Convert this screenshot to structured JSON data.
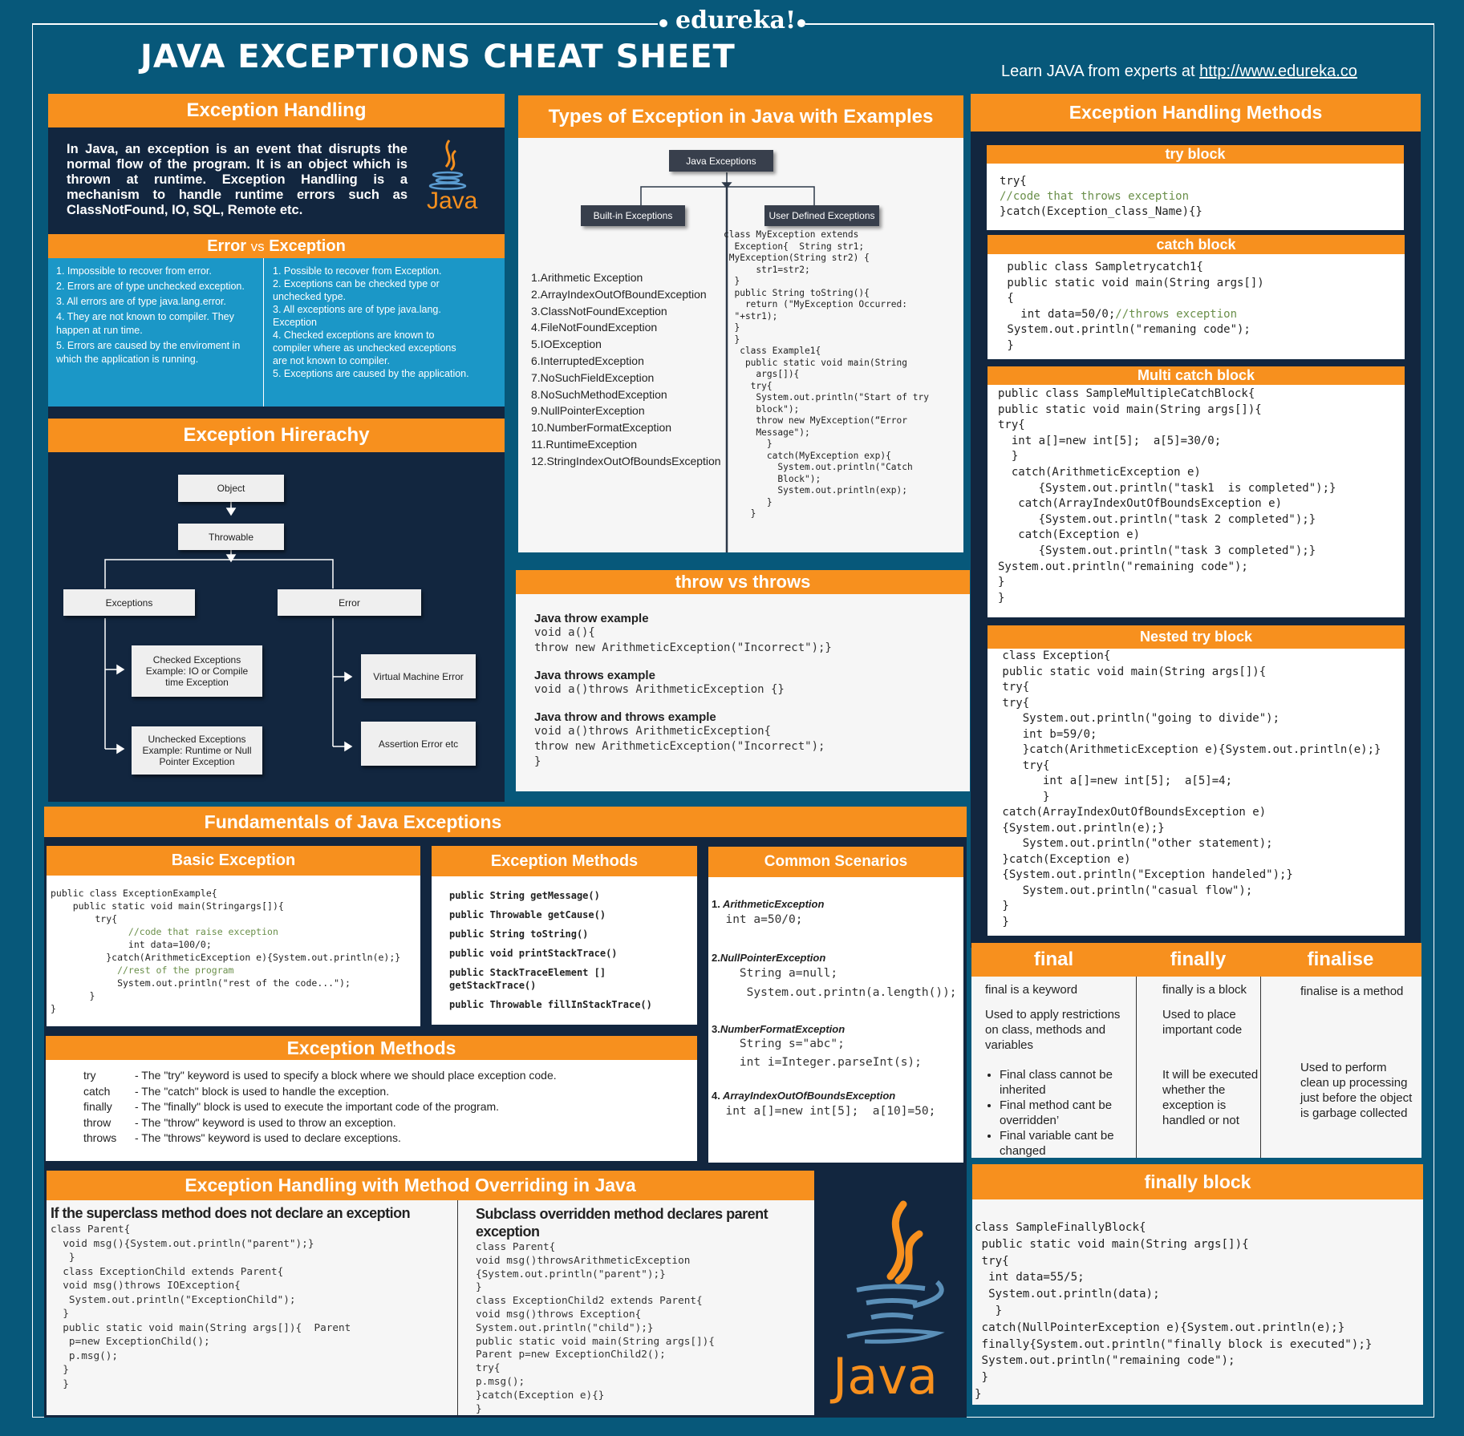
{
  "header": {
    "brand": "edureka!",
    "title": "JAVA EXCEPTIONS CHEAT  SHEET",
    "learn_prefix": "Learn JAVA from experts at ",
    "learn_link": "http://www.edureka.co"
  },
  "exception_handling": {
    "title": "Exception Handling",
    "text": "In Java, an exception is an event that disrupts the normal flow of the program. It is an object which is thrown at runtime. Exception Handling is a mechanism to handle runtime errors such as ClassNotFound, IO, SQL, Remote etc.",
    "logo_text": "Java"
  },
  "error_vs_exception": {
    "title_a": "Error",
    "title_vs": "vs",
    "title_b": "Exception",
    "errors": [
      "1. Impossible to recover from error.",
      "2. Errors are of type unchecked exception.",
      "3. All errors are of type java.lang.error.",
      "4. They are not known to compiler. They happen at run time.",
      "5. Errors are caused by the enviroment in which the application is running."
    ],
    "exceptions": [
      "1. Possible to recover from Exception.",
      "2. Exceptions can be checked type or unchecked type.",
      "3. All exceptions are of type java.lang. Exception",
      "4. Checked exceptions are known to compiler where as unchecked exceptions are not known to compiler.",
      "5. Exceptions are caused by the application."
    ]
  },
  "hierarchy": {
    "title": "Exception Hirerachy",
    "object": "Object",
    "throwable": "Throwable",
    "exceptions": "Exceptions",
    "error": "Error",
    "checked": "Checked Exceptions Example: IO or Compile time Exception",
    "unchecked": "Unchecked Exceptions Example: Runtime or Null Pointer Exception",
    "vm_error": "Virtual Machine Error",
    "assertion": "Assertion Error etc"
  },
  "types": {
    "title": "Types of Exception in Java with Examples",
    "root": "Java Exceptions",
    "builtin": "Built-in Exceptions",
    "userdef": "User Defined Exceptions",
    "builtin_list": [
      "1.Arithmetic Exception",
      "2.ArrayIndexOutOfBoundException",
      "3.ClassNotFoundException",
      "4.FileNotFoundException",
      "5.IOException",
      "6.InterruptedException",
      "7.NoSuchFieldException",
      "8.NoSuchMethodException",
      "9.NullPointerException",
      "10.NumberFormatException",
      "11.RuntimeException",
      "12.StringIndexOutOfBoundsException"
    ],
    "user_code": "class MyException extends\n  Exception{  String str1;\n MyException(String str2) {\n      str1=str2;\n  }\n  public String toString(){\n    return (\"MyException Occurred:\n  \"+str1);\n  }\n  }\n   class Example1{\n    public static void main(String\n      args[]){\n     try{\n      System.out.println(\"Start of try\n      block\");\n      throw new MyException(“Error\n      Message\");\n        }\n        catch(MyException exp){\n          System.out.println(\"Catch\n          Block\");\n          System.out.println(exp);\n        }\n     }"
  },
  "throw_vs_throws": {
    "title": "throw vs throws",
    "items": [
      {
        "heading": "Java throw example",
        "code": "void a(){\nthrow new ArithmeticException(\"Incorrect\");}"
      },
      {
        "heading": "Java throws example",
        "code": "void a()throws ArithmeticException {}"
      },
      {
        "heading": "Java throw and throws example",
        "code": "void a()throws ArithmeticException{\nthrow new ArithmeticException(\"Incorrect\");\n}"
      }
    ]
  },
  "handling_methods": {
    "title": "Exception Handling Methods",
    "try_block": {
      "title": "try block",
      "line1": "try{",
      "comment": "//code that throws exception",
      "line3": "}catch(Exception_class_Name){}"
    },
    "catch_block": {
      "title": "catch block",
      "code_before": " public class Sampletrycatch1{\n public static void main(String args[])\n {\n   int data=50/0;",
      "comment": "//throws exception",
      "code_after": "\n System.out.println(\"remaning code\");\n }"
    },
    "multi_catch": {
      "title": "Multi catch block",
      "code": "public class SampleMultipleCatchBlock{\npublic static void main(String args[]){\ntry{\n  int a[]=new int[5];  a[5]=30/0;\n  }\n  catch(ArithmeticException e)\n      {System.out.println(\"task1  is completed\");}\n   catch(ArrayIndexOutOfBoundsException e)\n      {System.out.println(\"task 2 completed\");}\n   catch(Exception e)\n      {System.out.println(\"task 3 completed\");}\nSystem.out.println(\"remaining code\");\n}\n}"
    },
    "nested_try": {
      "title": "Nested try block",
      "code": " class Exception{\n public static void main(String args[]){\n try{\n try{\n    System.out.println(\"going to divide\");\n    int b=59/0;\n    }catch(ArithmeticException e){System.out.println(e);}\n    try{\n       int a[]=new int[5];  a[5]=4;\n       }\n catch(ArrayIndexOutOfBoundsException e)\n {System.out.println(e);}\n    System.out.println(\"other statement);\n }catch(Exception e)\n {System.out.println(\"Exception handeled\");}\n    System.out.println(\"casual flow\");\n }\n }"
    }
  },
  "fundamentals": {
    "title": "Fundamentals of Java Exceptions",
    "basic": {
      "title": "Basic Exception",
      "l1": "public class ExceptionExample{\n    public static void main(Stringargs[]){\n        try{",
      "c1": "              //code that raise exception",
      "l2": "              int data=100/0;\n          }catch(ArithmeticException e){System.out.println(e);}",
      "c2": "            //rest of the program",
      "l3": "            System.out.println(\"rest of the code...\");\n       }\n}"
    },
    "methods": {
      "title": "Exception Methods",
      "items": [
        "public String getMessage()",
        "public Throwable getCause()",
        "public String toString()",
        "public void printStackTrace()",
        "public StackTraceElement [] getStackTrace()",
        "public Throwable fillInStackTrace()"
      ]
    },
    "scenarios": {
      "title": "Common Scenarios",
      "items": [
        {
          "num": "1.",
          "name": "ArithmeticException",
          "code": "  int a=50/0;"
        },
        {
          "num": "2.",
          "name": "NullPointerException",
          "code": "    String a=null;\n     System.out.printn(a.length());"
        },
        {
          "num": "3.",
          "name": "NumberFormatException",
          "code": "    String s=\"abc\";\n    int i=Integer.parseInt(s);"
        },
        {
          "num": "4.",
          "name": "ArrayIndexOutOfBoundsException",
          "code": "  int a[]=new int[5];  a[10]=50;"
        }
      ]
    }
  },
  "keywords": {
    "title": "Exception Methods",
    "items": [
      {
        "kw": "try",
        "desc": "-  The \"try\" keyword is used to specify a block where we should place exception code."
      },
      {
        "kw": "catch",
        "desc": "- The \"catch\" block is used to handle the exception."
      },
      {
        "kw": "finally",
        "desc": "- The \"finally\" block is used to execute the important code of the program."
      },
      {
        "kw": "throw",
        "desc": "-  The \"throw\" keyword is used to throw an exception."
      },
      {
        "kw": "throws",
        "desc": "- The \"throws\" keyword is used to declare exceptions."
      }
    ]
  },
  "final_table": {
    "cols": [
      {
        "title": "final",
        "p1": "final is a keyword",
        "p2": "Used to apply restrictions on class, methods and variables",
        "bullets": [
          "Final class cannot be inherited",
          "Final method cant be overridden’",
          "Final variable cant be changed"
        ]
      },
      {
        "title": "finally",
        "p1": "finally is a block",
        "p2": "Used to place important code",
        "p3": "It will be executed whether the exception is handled or not"
      },
      {
        "title": "finalise",
        "p1": "finalise is a method",
        "p3": "Used to perform clean up processing just before the object is garbage collected"
      }
    ]
  },
  "finally_block": {
    "title": "finally block",
    "code": "class SampleFinallyBlock{\n public static void main(String args[]){\n try{\n  int data=55/5;\n  System.out.println(data);\n   }\n catch(NullPointerException e){System.out.println(e);}\n finally{System.out.println(\"finally block is executed\");}\n System.out.println(\"remaining code\");\n }\n}"
  },
  "overriding": {
    "title": "Exception Handling with Method Overriding in Java",
    "left_heading": "If the superclass method does not declare an exception",
    "left_code": "class Parent{\n  void msg(){System.out.println(\"parent\");}\n   }\n  class ExceptionChild extends Parent{\n  void msg()throws IOException{\n   System.out.println(\"ExceptionChild\");\n  }\n  public static void main(String args[]){  Parent\n   p=new ExceptionChild();\n   p.msg();\n  }\n  }",
    "right_heading": "Subclass overridden method declares parent exception",
    "right_code": "class Parent{\nvoid msg()throwsArithmeticException\n{System.out.println(\"parent\");}\n}\nclass ExceptionChild2 extends Parent{\nvoid msg()throws Exception{\nSystem.out.println(\"child\");}\npublic static void main(String args[]){\nParent p=new ExceptionChild2();\ntry{\np.msg();\n}catch(Exception e){}\n}",
    "logo_text": "Java"
  },
  "colors": {
    "background": "#07587a",
    "panel_dark": "#12263f",
    "orange": "#f7901e",
    "blue_panel": "#1b97c7",
    "box_dark": "#383f4c"
  }
}
